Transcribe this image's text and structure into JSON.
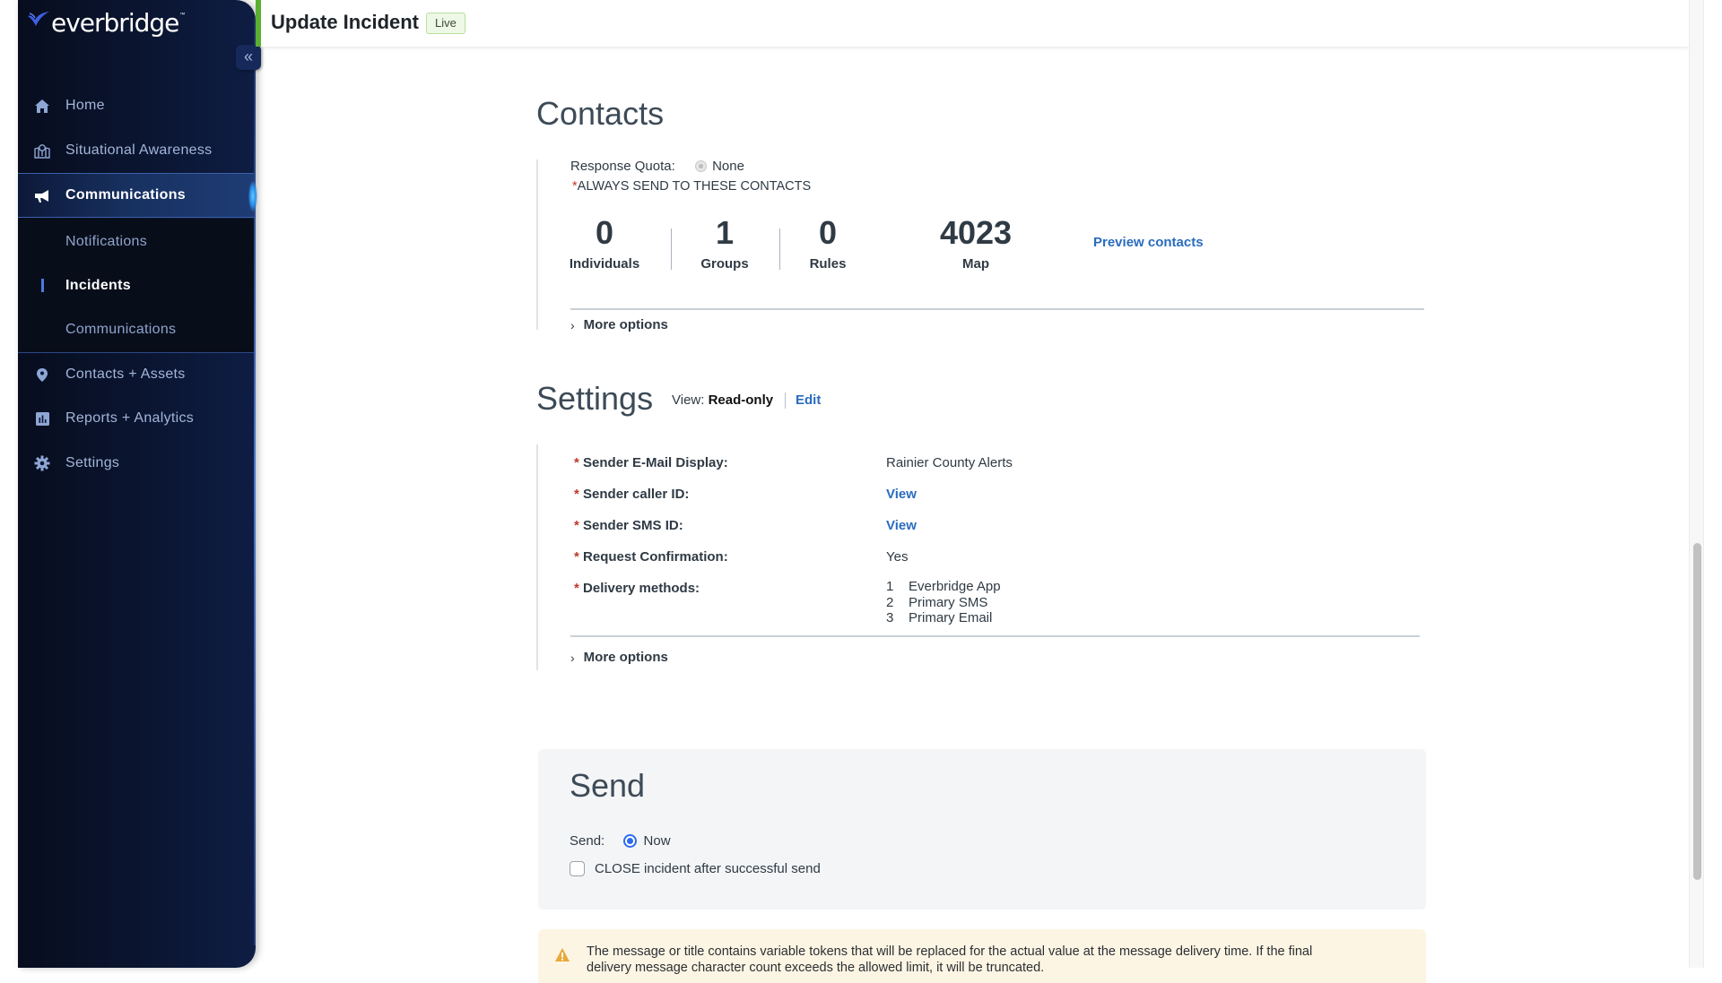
{
  "brand": {
    "name": "everbridge",
    "accent": "#3f5fe0"
  },
  "sidebar": {
    "collapse_label": "«",
    "items": [
      {
        "label": "Home",
        "icon": "home-icon"
      },
      {
        "label": "Situational Awareness",
        "icon": "map-pin-icon"
      },
      {
        "label": "Communications",
        "icon": "megaphone-icon",
        "active": true
      },
      {
        "label": "Contacts + Assets",
        "icon": "location-pin-icon"
      },
      {
        "label": "Reports + Analytics",
        "icon": "bar-chart-icon"
      },
      {
        "label": "Settings",
        "icon": "gear-icon"
      }
    ],
    "subitems": [
      {
        "label": "Notifications"
      },
      {
        "label": "Incidents",
        "active": true
      },
      {
        "label": "Communications"
      }
    ]
  },
  "header": {
    "title": "Update Incident",
    "status_badge": "Live",
    "status_color": "#5ab031"
  },
  "contacts": {
    "title": "Contacts",
    "response_quota_label": "Response Quota:",
    "response_quota_value": "None",
    "always_send_label": "ALWAYS SEND TO THESE CONTACTS",
    "stats": [
      {
        "value": "0",
        "label": "Individuals"
      },
      {
        "value": "1",
        "label": "Groups"
      },
      {
        "value": "0",
        "label": "Rules"
      },
      {
        "value": "4023",
        "label": "Map"
      }
    ],
    "preview_link": "Preview contacts",
    "more_options": "More options"
  },
  "settings": {
    "title": "Settings",
    "view_label": "View:",
    "view_mode": "Read-only",
    "edit_link": "Edit",
    "rows": [
      {
        "label": "Sender E-Mail Display:",
        "value": "Rainier County Alerts",
        "is_link": false
      },
      {
        "label": "Sender caller ID:",
        "value": "View",
        "is_link": true
      },
      {
        "label": "Sender SMS ID:",
        "value": "View",
        "is_link": true
      },
      {
        "label": "Request Confirmation:",
        "value": "Yes",
        "is_link": false
      },
      {
        "label": "Delivery methods:"
      }
    ],
    "delivery_methods": [
      {
        "order": "1",
        "name": "Everbridge App"
      },
      {
        "order": "2",
        "name": "Primary SMS"
      },
      {
        "order": "3",
        "name": "Primary Email"
      }
    ],
    "more_options": "More options"
  },
  "send": {
    "title": "Send",
    "send_label": "Send:",
    "send_option": "Now",
    "close_checkbox_label": "CLOSE incident after successful send",
    "close_checked": false
  },
  "warning": {
    "line1": "The message or title contains variable tokens that will be replaced for the actual value at the message delivery time. If the final",
    "line2": "delivery message character count exceeds the allowed limit, it will be truncated."
  }
}
